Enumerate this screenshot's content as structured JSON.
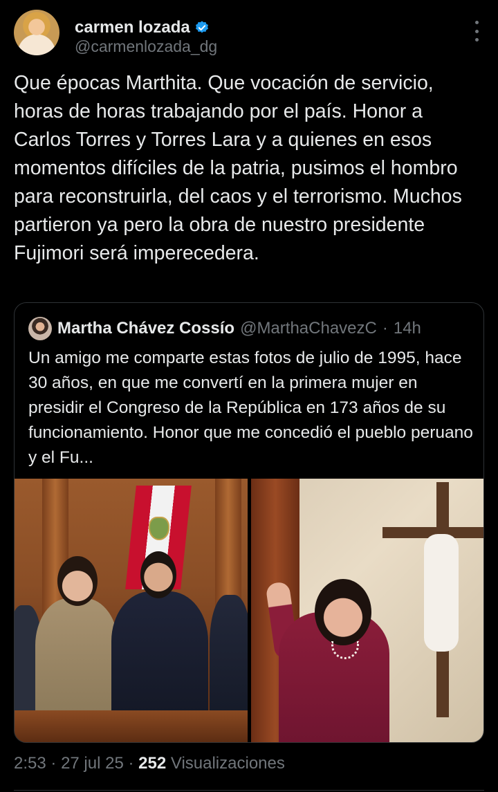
{
  "author": {
    "display_name": "carmen lozada",
    "handle": "@carmenlozada_dg",
    "verified": true,
    "verified_color": "#1d9bf0"
  },
  "tweet": {
    "text": "Que épocas Marthita. Que vocación de servicio, horas de horas trabajando por el país. Honor a Carlos Torres y Torres Lara y a quienes en esos momentos difíciles de la patria, pusimos el hombro para reconstruirla, del caos y el terrorismo. Muchos partieron ya pero la obra de nuestro presidente Fujimori será imperecedera."
  },
  "quoted_tweet": {
    "display_name": "Martha Chávez Cossío",
    "handle": "@MarthaChavezC",
    "separator": "·",
    "age": "14h",
    "text": "Un amigo me comparte estas fotos de julio de 1995, hace 30 años, en que me convertí en la primera mujer en presidir el Congreso de la República en 173 años de su funcionamiento. Honor que me concedió el pueblo peruano y el Fu..."
  },
  "footer": {
    "time": "2:53",
    "date": "27 jul 25",
    "views_count": "252",
    "views_label": "Visualizaciones",
    "sep": "·"
  },
  "icons": {
    "more": "more-vertical-icon",
    "verified": "verified-badge-icon"
  },
  "colors": {
    "background": "#000000",
    "text_primary": "#e7e9ea",
    "text_secondary": "#71767b",
    "border": "#2f3336"
  }
}
